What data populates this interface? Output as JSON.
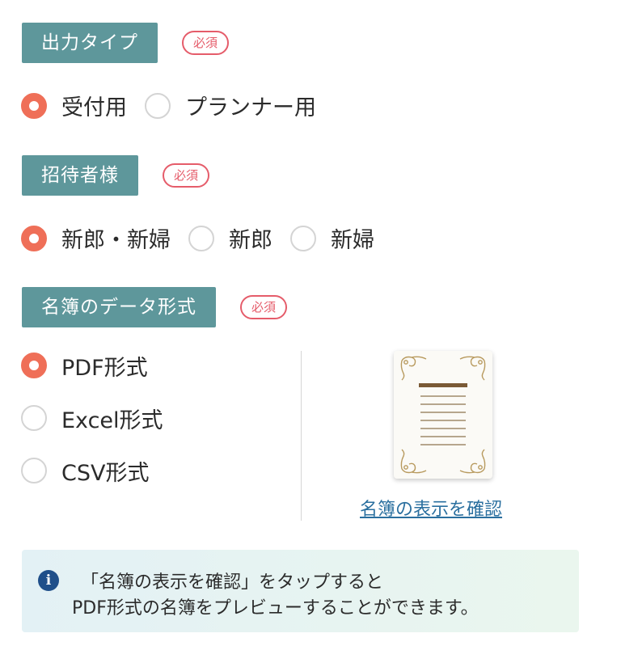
{
  "output_type": {
    "label": "出力タイプ",
    "required": "必須",
    "options": [
      {
        "label": "受付用",
        "selected": true
      },
      {
        "label": "プランナー用",
        "selected": false
      }
    ]
  },
  "invitees": {
    "label": "招待者様",
    "required": "必須",
    "options": [
      {
        "label": "新郎・新婦",
        "selected": true
      },
      {
        "label": "新郎",
        "selected": false
      },
      {
        "label": "新婦",
        "selected": false
      }
    ]
  },
  "data_format": {
    "label": "名簿のデータ形式",
    "required": "必須",
    "options": [
      {
        "label": "PDF形式",
        "selected": true
      },
      {
        "label": "Excel形式",
        "selected": false
      },
      {
        "label": "CSV形式",
        "selected": false
      }
    ],
    "preview_link": "名簿の表示を確認"
  },
  "info": {
    "icon": "info-icon",
    "line1": "「名簿の表示を確認」をタップすると",
    "line2": "PDF形式の名簿をプレビューすることができます。"
  },
  "colors": {
    "tag": "#5e979b",
    "required": "#e55c6a",
    "radio_selected": "#ef6f58",
    "link": "#2a6f9f",
    "info_icon": "#1f4f8a"
  }
}
